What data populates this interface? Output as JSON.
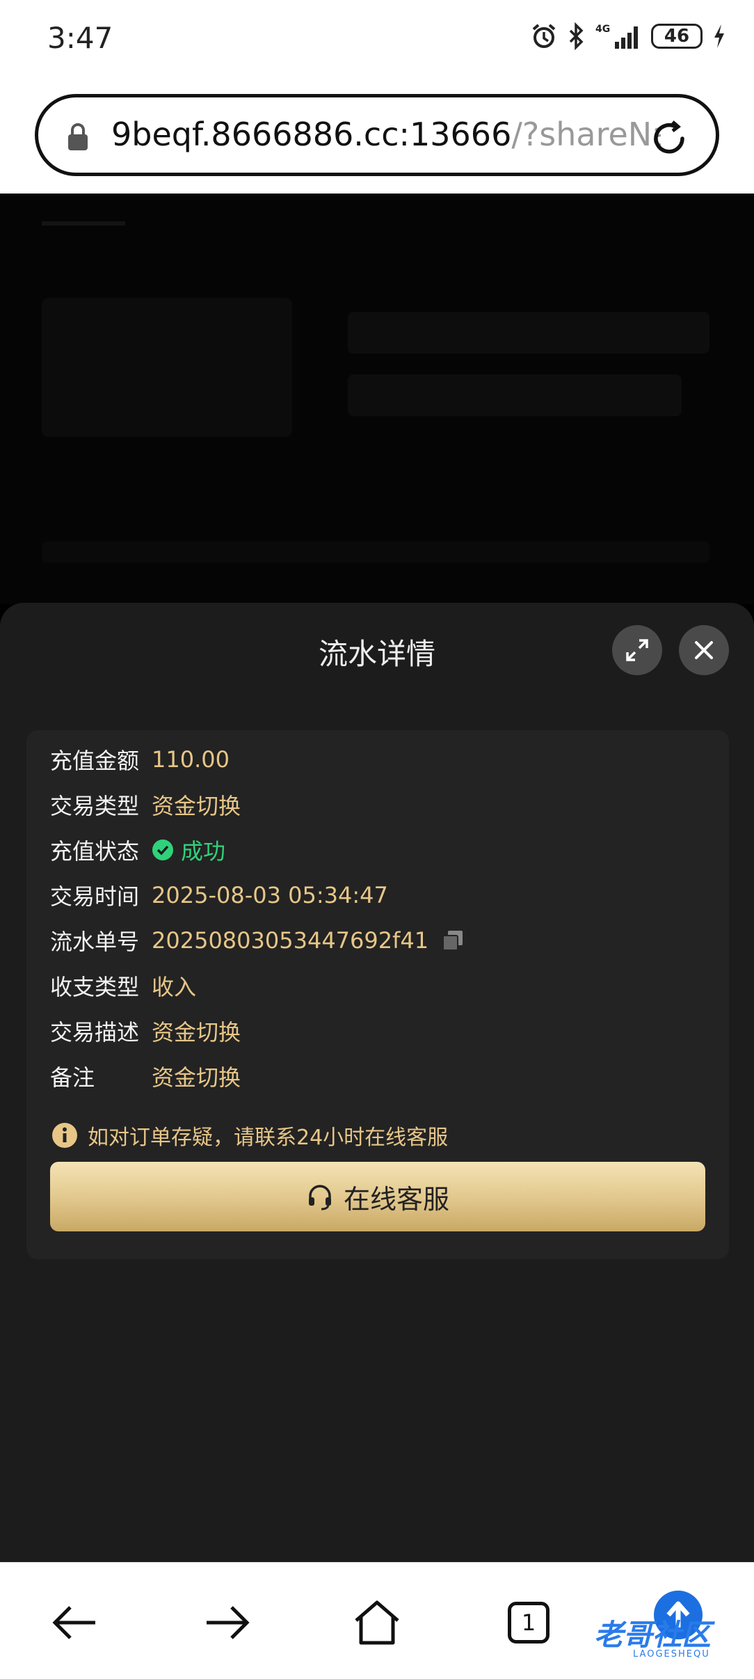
{
  "status_bar": {
    "time": "3:47",
    "network": "4G",
    "battery": "46",
    "icons": [
      "alarm-icon",
      "bluetooth-icon",
      "signal-icon",
      "battery-icon",
      "charging-icon"
    ]
  },
  "browser": {
    "url_main": "9beqf.8666886.cc:13666",
    "url_rest": "/?shareNa"
  },
  "modal": {
    "title": "流水详情",
    "rows": [
      {
        "label": "充值金额",
        "value": "110.00"
      },
      {
        "label": "交易类型",
        "value": "资金切换"
      },
      {
        "label": "充值状态",
        "value": "成功"
      },
      {
        "label": "交易时间",
        "value": "2025-08-03 05:34:47"
      },
      {
        "label": "流水单号",
        "value": "20250803053447692f41"
      },
      {
        "label": "收支类型",
        "value": "收入"
      },
      {
        "label": "交易描述",
        "value": "资金切换"
      },
      {
        "label": "备注",
        "value": "资金切换"
      }
    ],
    "notice": "如对订单存疑，请联系24小时在线客服",
    "service_button": "在线客服"
  },
  "bottom_nav": {
    "tab_count": "1",
    "watermark": "老哥社区",
    "watermark_sub": "LAOGESHEQU"
  },
  "colors": {
    "sheet_bg": "#1c1c1c",
    "card_bg": "#232323",
    "gold_text": "#e7c688",
    "success_green": "#2fd27a"
  }
}
